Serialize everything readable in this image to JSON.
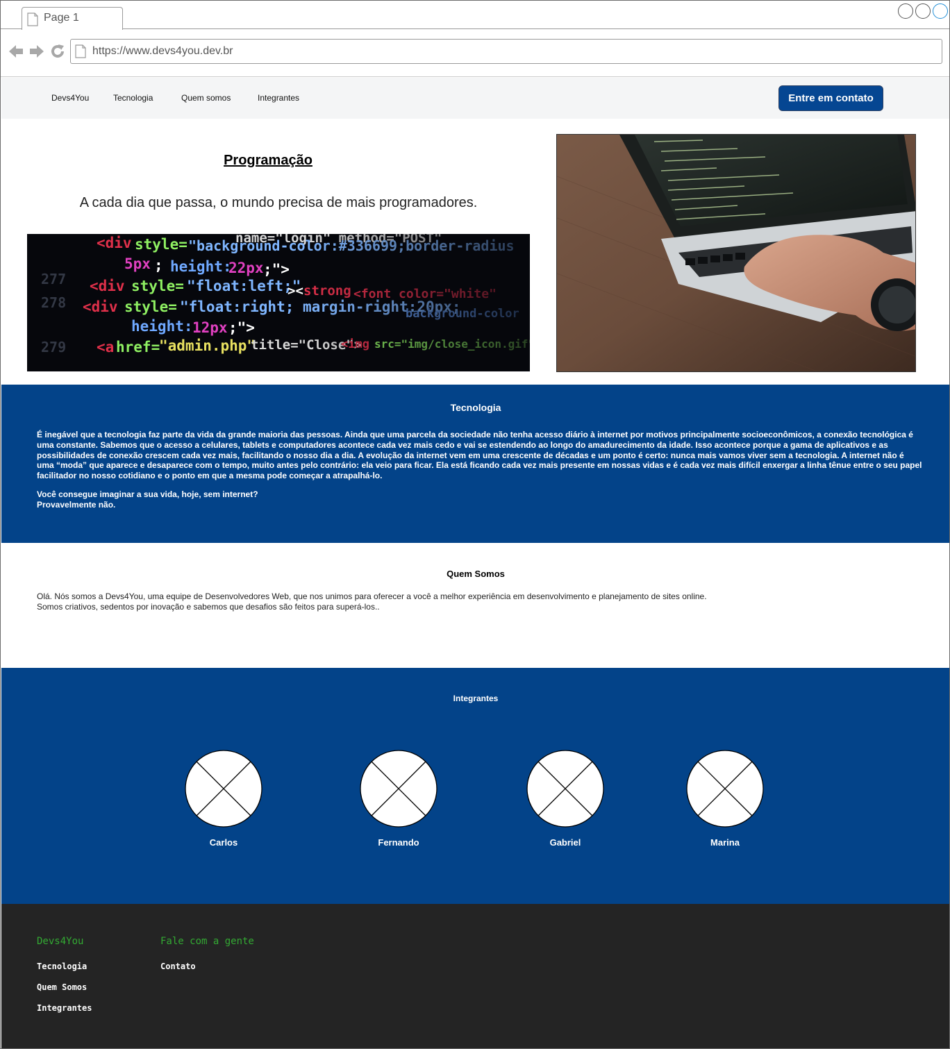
{
  "browser": {
    "tab_title": "Page 1",
    "url": "https://www.devs4you.dev.br"
  },
  "nav": {
    "links": [
      "Devs4You",
      "Tecnologia",
      "Quem somos",
      "Integrantes"
    ],
    "cta": "Entre em contato"
  },
  "hero": {
    "title": "Programação",
    "subtitle": "A cada dia que passa, o mundo precisa de mais programadores."
  },
  "tecnologia": {
    "title": "Tecnologia",
    "paragraph": "É inegável que a tecnologia faz parte da vida da grande maioria das pessoas. Ainda que uma parcela da sociedade não tenha acesso diário à internet por motivos principalmente socioeconômicos, a conexão tecnológica é uma constante. Sabemos que o acesso a celulares, tablets e computadores acontece cada vez mais cedo e vai se estendendo ao longo do amadurecimento da idade. Isso acontece porque a gama de aplicativos e as possibilidades de conexão crescem cada vez mais, facilitando o nosso dia a dia. A evolução da internet vem em uma crescente de décadas e um ponto é certo: nunca mais vamos viver sem a tecnologia. A internet não é uma “moda” que aparece e desaparece com o tempo, muito antes pelo contrário: ela veio para ficar. Ela está ficando cada vez mais presente em nossas vidas e é cada vez mais difícil enxergar a linha tênue entre o seu papel facilitador no nosso cotidiano e o ponto em que a mesma pode começar a atrapalhá-lo.",
    "question": "Você consegue imaginar a sua vida, hoje, sem internet?",
    "answer": "Provavelmente não."
  },
  "quem_somos": {
    "title": "Quem Somos",
    "line1": "Olá. Nós somos a Devs4You, uma equipe de Desenvolvedores Web, que nos unimos para oferecer a você a melhor experiência em desenvolvimento e planejamento de sites online.",
    "line2": "Somos criativos, sedentos por inovação e sabemos que desafios são feitos para superá-los.."
  },
  "integrantes": {
    "title": "Integrantes",
    "members": [
      "Carlos",
      "Fernando",
      "Gabriel",
      "Marina"
    ]
  },
  "footer": {
    "col1_title": "Devs4You",
    "col1_links": [
      "Tecnologia",
      "Quem Somos",
      "Integrantes"
    ],
    "col2_title": "Fale com a gente",
    "col2_links": [
      "Contato"
    ]
  },
  "colors": {
    "brand_blue": "#034389",
    "cta_blue": "#054692",
    "footer_bg": "#242424",
    "footer_accent": "#33aa33"
  }
}
